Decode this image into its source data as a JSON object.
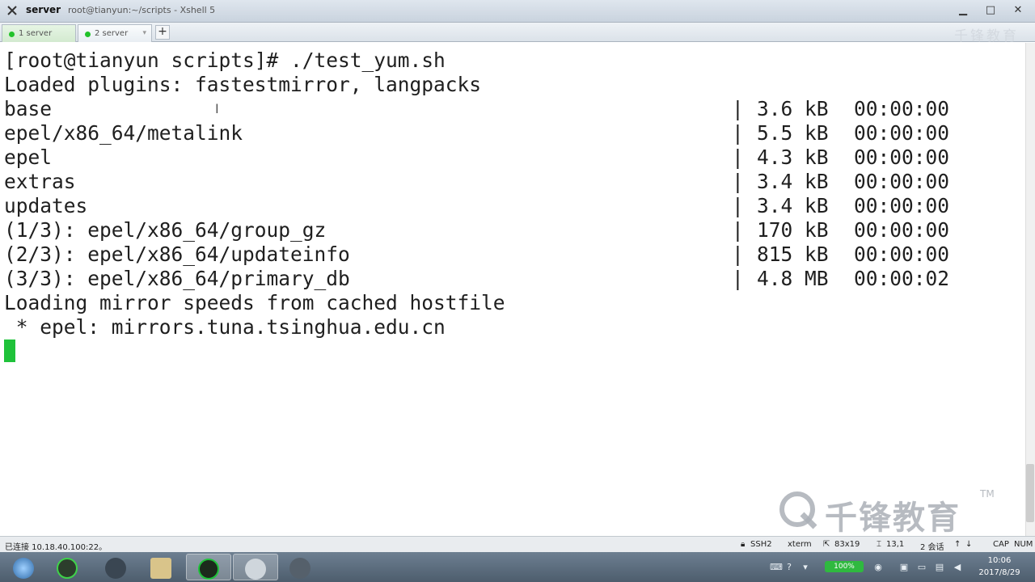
{
  "window": {
    "session_name": "server",
    "full_title": "root@tianyun:~/scripts - Xshell 5"
  },
  "tabs": [
    {
      "label": "1 server",
      "active": true
    },
    {
      "label": "2 server",
      "active": false
    }
  ],
  "tab_add_label": "+",
  "terminal": {
    "prompt_line": "[root@tianyun scripts]# ./test_yum.sh",
    "plugins_line": "Loaded plugins: fastestmirror, langpacks",
    "repo_rows": [
      {
        "name": "base",
        "size": "3.6 kB",
        "time": "00:00:00"
      },
      {
        "name": "epel/x86_64/metalink",
        "size": "5.5 kB",
        "time": "00:00:00"
      },
      {
        "name": "epel",
        "size": "4.3 kB",
        "time": "00:00:00"
      },
      {
        "name": "extras",
        "size": "3.4 kB",
        "time": "00:00:00"
      },
      {
        "name": "updates",
        "size": "3.4 kB",
        "time": "00:00:00"
      },
      {
        "name": "(1/3): epel/x86_64/group_gz",
        "size": "170 kB",
        "time": "00:00:00"
      },
      {
        "name": "(2/3): epel/x86_64/updateinfo",
        "size": "815 kB",
        "time": "00:00:00"
      },
      {
        "name": "(3/3): epel/x86_64/primary_db",
        "size": "4.8 MB",
        "time": "00:00:02"
      }
    ],
    "separator": "|",
    "mirror_line": "Loading mirror speeds from cached hostfile",
    "epel_mirror_line": " * epel: mirrors.tuna.tsinghua.edu.cn",
    "cursor_color": "#1fc23a"
  },
  "watermark": {
    "text": "千锋教育",
    "tm": "TM"
  },
  "statusbar": {
    "connection": "已连接 10.18.40.100:22。",
    "protocol": "SSH2",
    "term": "xterm",
    "size": "83x19",
    "position": "13,1",
    "sessions": "2 会话",
    "cap": "CAP",
    "num": "NUM"
  },
  "taskbar": {
    "clock_time": "10:06",
    "clock_date": "2017/8/29",
    "net_label": "100%"
  },
  "colors": {
    "accent_green": "#22c22a",
    "taskbar": "#5a6b7c"
  }
}
